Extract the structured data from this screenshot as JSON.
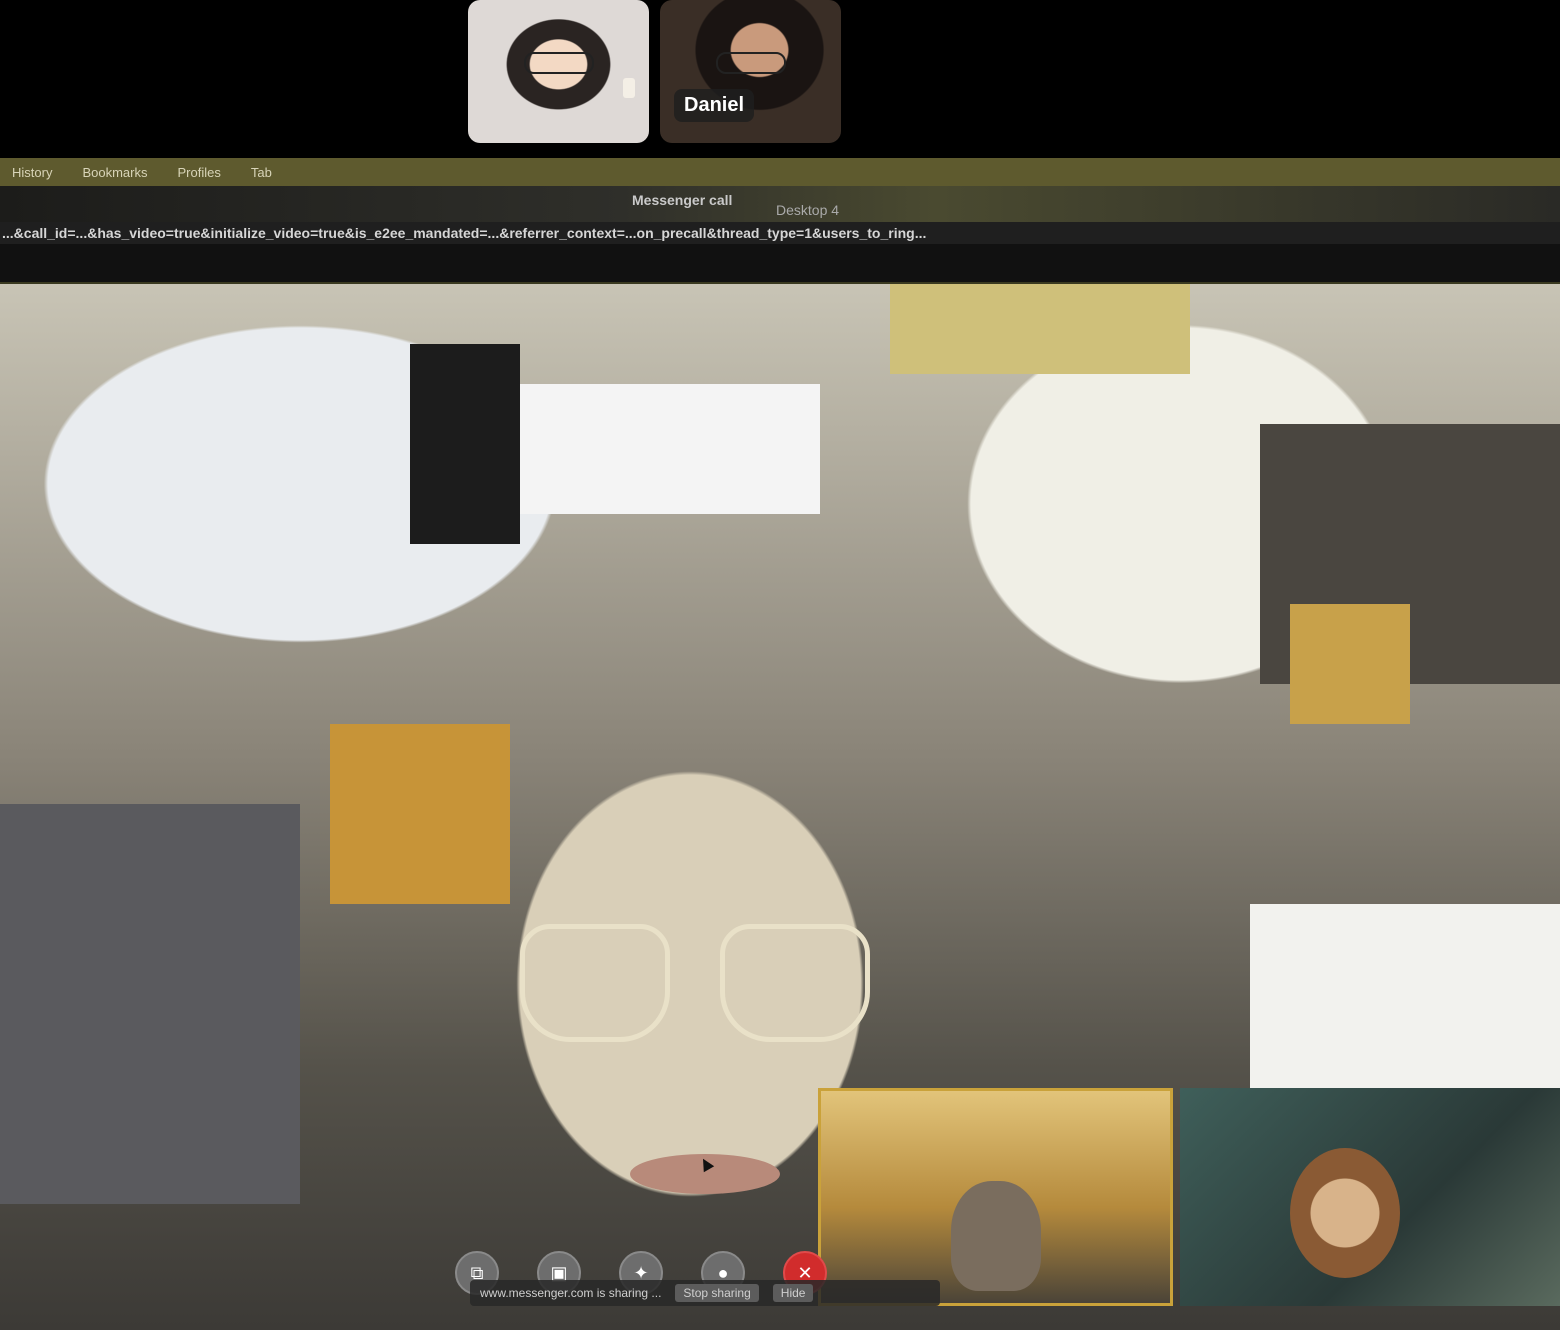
{
  "participants": [
    {
      "id": "p1",
      "name": ""
    },
    {
      "id": "p2",
      "name": "Daniel"
    }
  ],
  "shared_screen": {
    "menu_items": [
      "History",
      "Bookmarks",
      "Profiles",
      "Tab"
    ],
    "window_title": "Messenger call",
    "desktop_label": "Desktop 4",
    "url_text": "...&call_id=...&has_video=true&initialize_video=true&is_e2ee_mandated=...&referrer_context=...on_precall&thread_type=1&users_to_ring...",
    "share_banner": {
      "text": "www.messenger.com is sharing ...",
      "stop_label": "Stop sharing",
      "hide_label": "Hide"
    }
  },
  "controls": {
    "buttons": [
      {
        "name": "share-screen-button",
        "icon": "screen-share-icon",
        "glyph": "⧉"
      },
      {
        "name": "camera-button",
        "icon": "camera-icon",
        "glyph": "▣"
      },
      {
        "name": "effects-button",
        "icon": "effects-icon",
        "glyph": "✦"
      },
      {
        "name": "mic-button",
        "icon": "microphone-icon",
        "glyph": "●"
      },
      {
        "name": "end-call-button",
        "icon": "end-call-icon",
        "glyph": "✕"
      }
    ]
  },
  "colors": {
    "end_call": "#d12c2c",
    "menubar": "#5e5a2e",
    "self_view_border": "#caa23a"
  }
}
